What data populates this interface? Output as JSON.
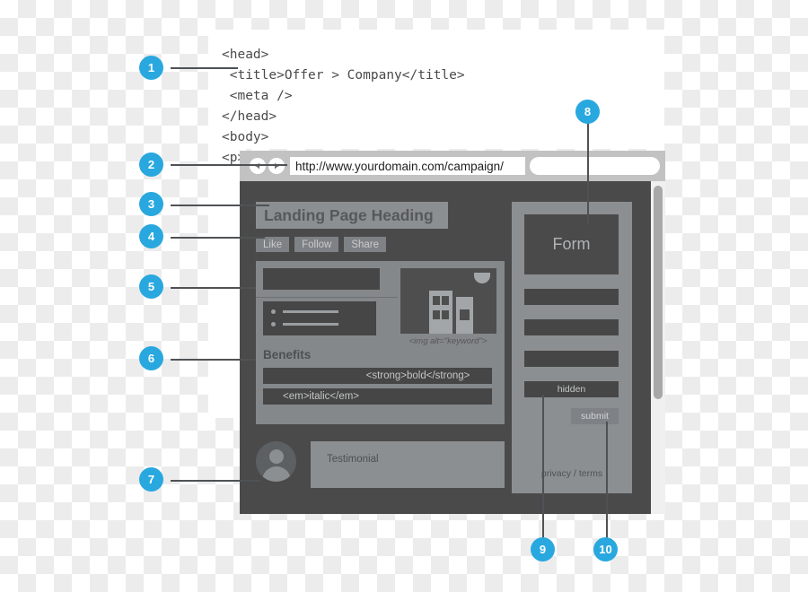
{
  "code_block": {
    "lines": "<head>\n <title>Offer > Company</title>\n <meta />\n</head>\n<body>\n<p>Benefits</p>"
  },
  "browser": {
    "back_icon": "arrow-left-icon",
    "forward_icon": "arrow-right-icon",
    "url": "http://www.yourdomain.com/campaign/",
    "search_value": ""
  },
  "landing_page": {
    "heading": "Landing Page Heading",
    "social_buttons": [
      {
        "label": "Like"
      },
      {
        "label": "Follow"
      },
      {
        "label": "Share"
      }
    ],
    "image_caption": "<img alt=\"keyword\">",
    "benefits_title": "Benefits",
    "bar_strong": "<strong>bold</strong>",
    "bar_italic": "<em>italic</em>",
    "testimonial": "Testimonial"
  },
  "form": {
    "title": "Form",
    "hidden_field": "hidden",
    "submit_button": "submit",
    "privacy_terms": "privacy / terms"
  },
  "callouts": [
    {
      "number": "1"
    },
    {
      "number": "2"
    },
    {
      "number": "3"
    },
    {
      "number": "4"
    },
    {
      "number": "5"
    },
    {
      "number": "6"
    },
    {
      "number": "7"
    },
    {
      "number": "8"
    },
    {
      "number": "9"
    },
    {
      "number": "10"
    }
  ],
  "colors": {
    "badge": "#28a8df",
    "chrome": "#c2c2c2",
    "viewport": "#4a4a4a",
    "panel": "#8c8f92",
    "field": "#464646"
  }
}
